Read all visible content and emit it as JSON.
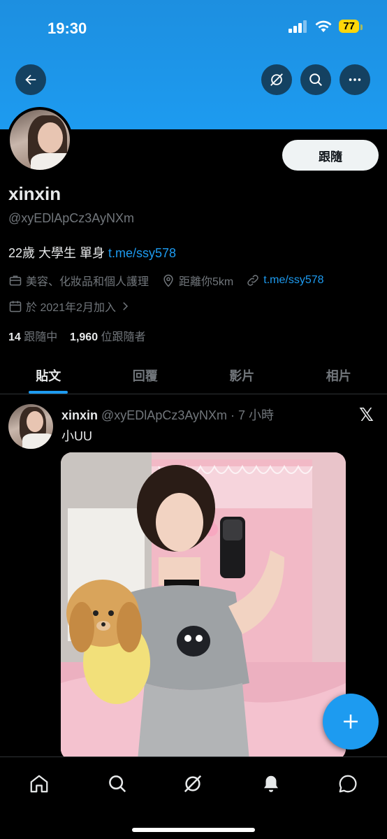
{
  "status_bar": {
    "time": "19:30",
    "battery": "77"
  },
  "header": {
    "back_icon": "arrow-left-icon",
    "grok_icon": "grok-icon",
    "search_icon": "search-icon",
    "more_icon": "more-icon"
  },
  "profile": {
    "follow_label": "跟隨",
    "display_name": "xinxin",
    "handle": "@xyEDlApCz3AyNXm",
    "bio_text": "22歲 大學生 單身 ",
    "bio_link": "t.me/ssy578",
    "category": "美容、化妝品和個人護理",
    "location": "距離你5km",
    "website": "t.me/ssy578",
    "joined": "於 2021年2月加入",
    "following_count": "14",
    "following_label": "跟隨中",
    "followers_count": "1,960",
    "followers_label": "位跟隨者"
  },
  "tabs": [
    {
      "label": "貼文",
      "active": true
    },
    {
      "label": "回覆",
      "active": false
    },
    {
      "label": "影片",
      "active": false
    },
    {
      "label": "相片",
      "active": false
    }
  ],
  "tweet": {
    "author": "xinxin",
    "meta": "@xyEDlApCz3AyNXm · 7 小時",
    "text": "小UU",
    "source_icon": "x-logo-icon"
  },
  "colors": {
    "accent": "#1d9bf0",
    "background": "#000000",
    "muted": "#71767b",
    "text": "#e7e9ea",
    "battery": "#ffd60a"
  },
  "bottom_nav": [
    "home-icon",
    "search-icon",
    "grok-icon",
    "notifications-icon",
    "messages-icon"
  ]
}
